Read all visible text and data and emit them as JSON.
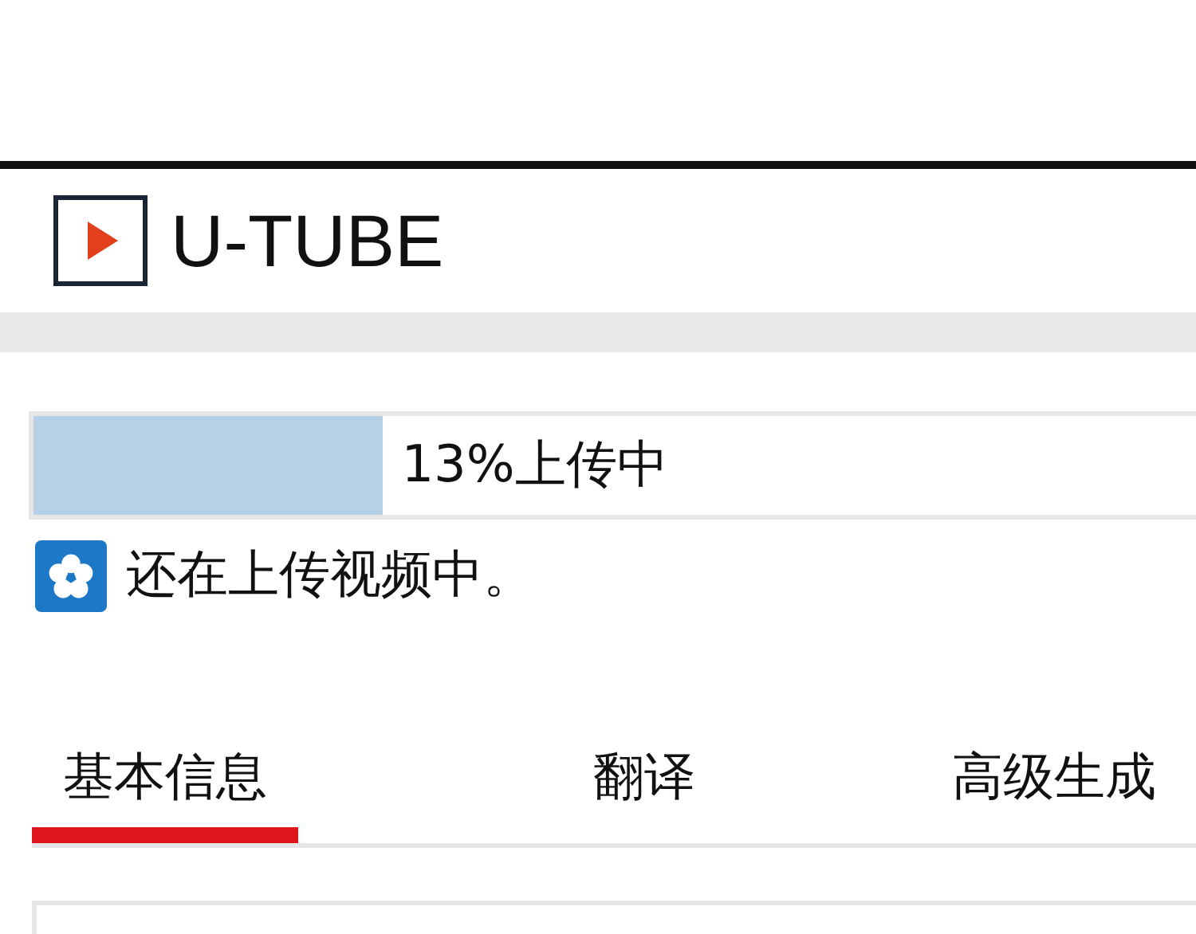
{
  "header": {
    "logo_text": "U-TUBE"
  },
  "upload": {
    "level": 0.3,
    "label": "13%上传中"
  },
  "notice": {
    "text": "还在上传视频中。"
  },
  "tabs": [
    {
      "label": "基本信息",
      "selected": true
    },
    {
      "label": "翻译",
      "selected": false
    },
    {
      "label": "高级生成",
      "selected": false
    }
  ]
}
